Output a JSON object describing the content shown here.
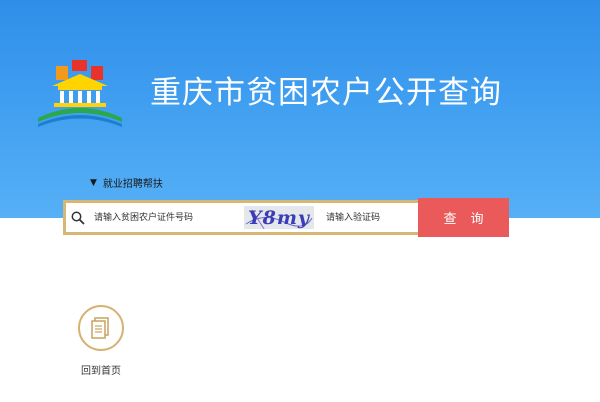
{
  "header": {
    "title": "重庆市贫困农户公开查询"
  },
  "tabs": {
    "active_tab": "就业招聘帮扶"
  },
  "search": {
    "id_placeholder": "请输入贫困农户证件号码",
    "captcha_text": "Y8my",
    "code_placeholder": "请输入验证码",
    "submit_label": "查询"
  },
  "nav": {
    "home_label": "回到首页"
  },
  "colors": {
    "hero": "#3f9ef0",
    "accent_gold": "#d8b774",
    "button_red": "#ea5a5a"
  },
  "icons": {
    "search": "search-icon",
    "home": "document-icon",
    "tab": "triangle-down-icon"
  }
}
